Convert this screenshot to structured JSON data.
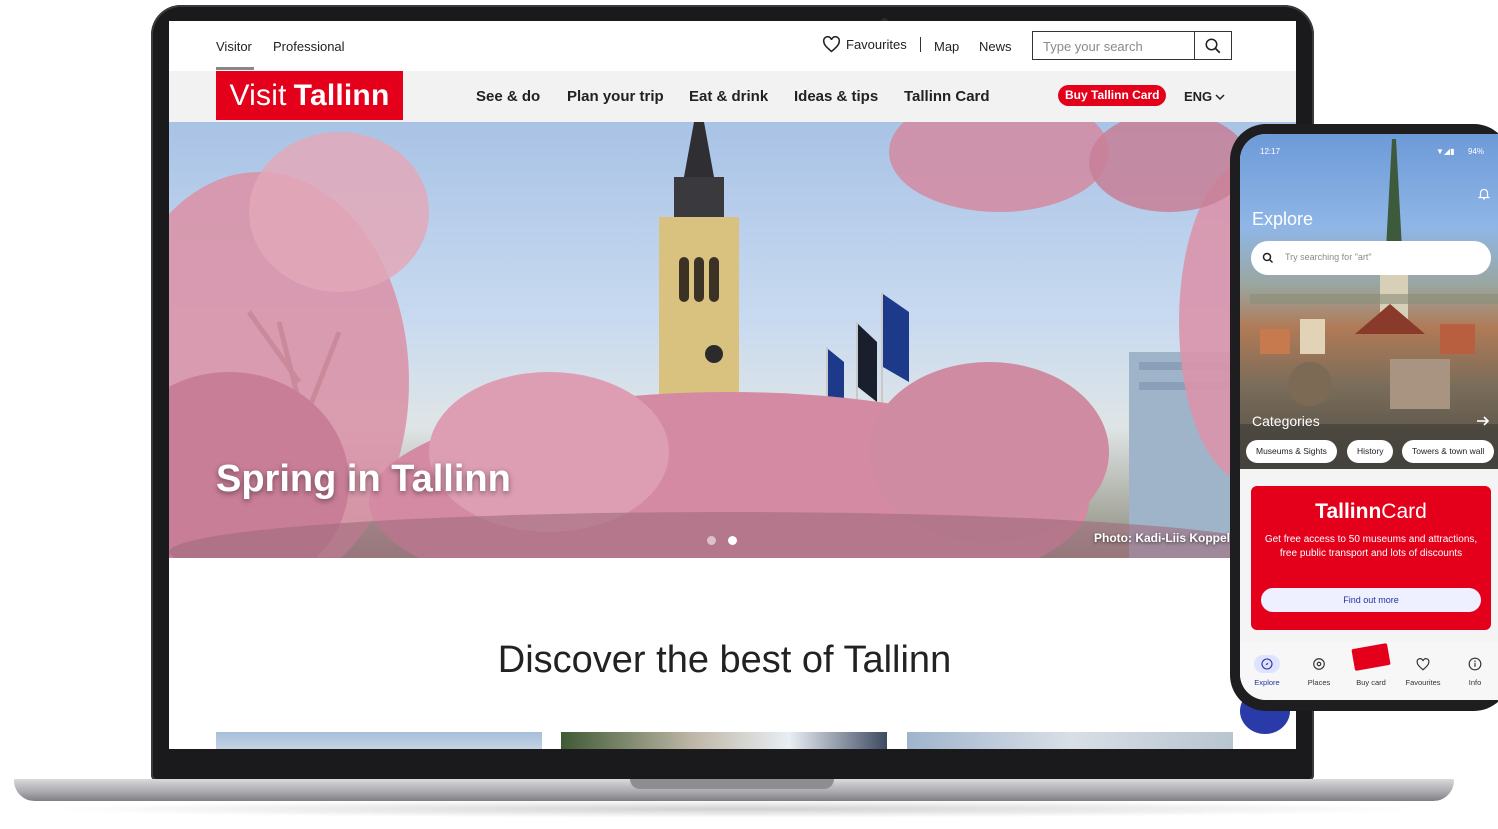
{
  "desktop": {
    "audience_tabs": [
      {
        "label": "Visitor"
      },
      {
        "label": "Professional"
      }
    ],
    "favourites_label": "Favourites",
    "map_label": "Map",
    "news_label": "News",
    "search_placeholder": "Type your search",
    "logo": {
      "part1": "Visit",
      "part2": "Tallinn"
    },
    "nav": [
      {
        "label": "See & do"
      },
      {
        "label": "Plan your trip"
      },
      {
        "label": "Eat & drink"
      },
      {
        "label": "Ideas & tips"
      },
      {
        "label": "Tallinn Card"
      }
    ],
    "buy_button": "Buy Tallinn Card",
    "language": "ENG",
    "hero": {
      "title": "Spring in Tallinn",
      "credit": "Photo: Kadi-Liis Koppel",
      "slide_count": 2,
      "active_slide": 2
    },
    "section_title": "Discover the best of Tallinn"
  },
  "phone": {
    "status_time": "12:17",
    "status_battery": "94%",
    "explore_title": "Explore",
    "search_placeholder": "Try searching for \"art\"",
    "categories_title": "Categories",
    "chips": [
      {
        "label": "Museums & Sights"
      },
      {
        "label": "History"
      },
      {
        "label": "Towers & town wall"
      }
    ],
    "card": {
      "brand_part1": "Tallinn",
      "brand_part2": "Card",
      "description": "Get free access to 50 museums and attractions, free public transport and lots of discounts",
      "button": "Find out more"
    },
    "tabs": [
      {
        "label": "Explore",
        "icon": "compass-icon"
      },
      {
        "label": "Places",
        "icon": "places-icon"
      },
      {
        "label": "Buy card",
        "icon": "tallinn-card-icon"
      },
      {
        "label": "Favourites",
        "icon": "heart-icon"
      },
      {
        "label": "Info",
        "icon": "info-icon"
      }
    ]
  },
  "colors": {
    "brand_red": "#e4001b",
    "accent_blue": "#2232a0",
    "nav_bg": "#f2f2f2"
  }
}
